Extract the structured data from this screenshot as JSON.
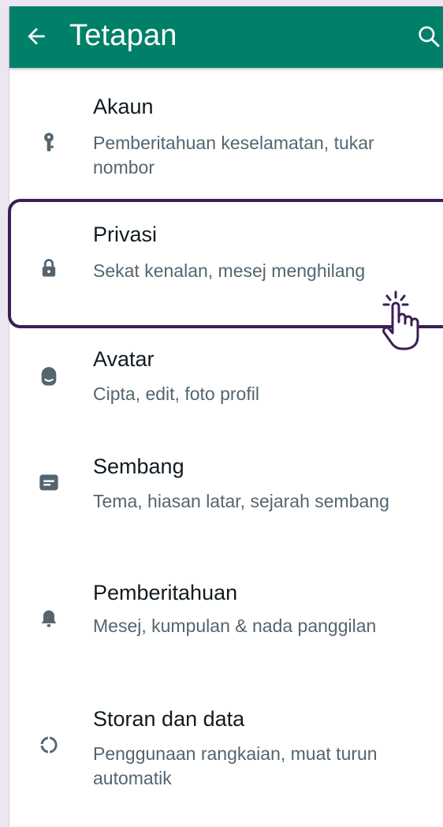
{
  "app_bar": {
    "title": "Tetapan",
    "back_icon": "arrow-left-icon",
    "search_icon": "search-icon",
    "color": "#008069"
  },
  "settings": [
    {
      "label": "Akaun",
      "sub": "Pemberitahuan keselamatan, tukar nombor",
      "icon": "key-icon"
    },
    {
      "label": "Privasi",
      "sub": "Sekat kenalan, mesej menghilang",
      "icon": "lock-icon",
      "highlighted": true
    },
    {
      "label": "Avatar",
      "sub": "Cipta, edit, foto profil",
      "icon": "avatar-icon"
    },
    {
      "label": "Sembang",
      "sub": "Tema, hiasan latar, sejarah sembang",
      "icon": "chat-icon"
    },
    {
      "label": "Pemberitahuan",
      "sub": "Mesej, kumpulan & nada panggilan",
      "icon": "bell-icon"
    },
    {
      "label": "Storan dan data",
      "sub": "Penggunaan rangkaian, muat turun automatik",
      "icon": "data-usage-icon"
    }
  ],
  "overlay": {
    "highlight_color": "#3b1f54",
    "cursor_icon": "tap-hand-icon"
  }
}
